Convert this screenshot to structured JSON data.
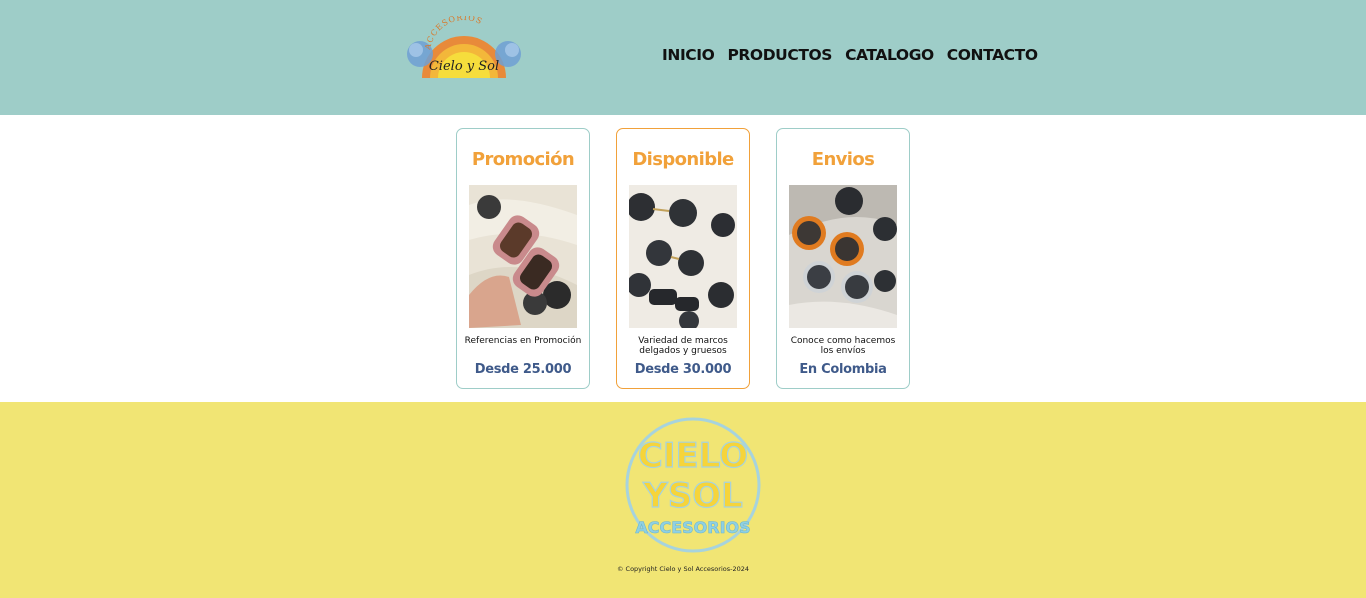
{
  "brand": {
    "logo_top_text": "ACCESORIOS",
    "logo_script_text": "Cielo y Sol"
  },
  "nav": {
    "items": [
      "INICIO",
      "PRODUCTOS",
      "CATALOGO",
      "CONTACTO"
    ]
  },
  "cards": [
    {
      "title": "Promoción",
      "text": "Referencias en Promoción",
      "price": "Desde 25.000"
    },
    {
      "title": "Disponible",
      "text": "Variedad de marcos delgados y gruesos",
      "price": "Desde 30.000"
    },
    {
      "title": "Envios",
      "text": "Conoce como hacemos los envíos",
      "price": "En Colombia"
    }
  ],
  "footer": {
    "badge_lines": [
      "CIELO",
      "YSOL",
      "ACCESORIOS"
    ],
    "copyright": "© Copyright Cielo y Sol Accesorios-2024"
  },
  "colors": {
    "header_bg": "#9ecdc8",
    "footer_bg": "#f1e574",
    "accent_orange": "#f1a13a",
    "price_blue": "#3f5a8a"
  }
}
